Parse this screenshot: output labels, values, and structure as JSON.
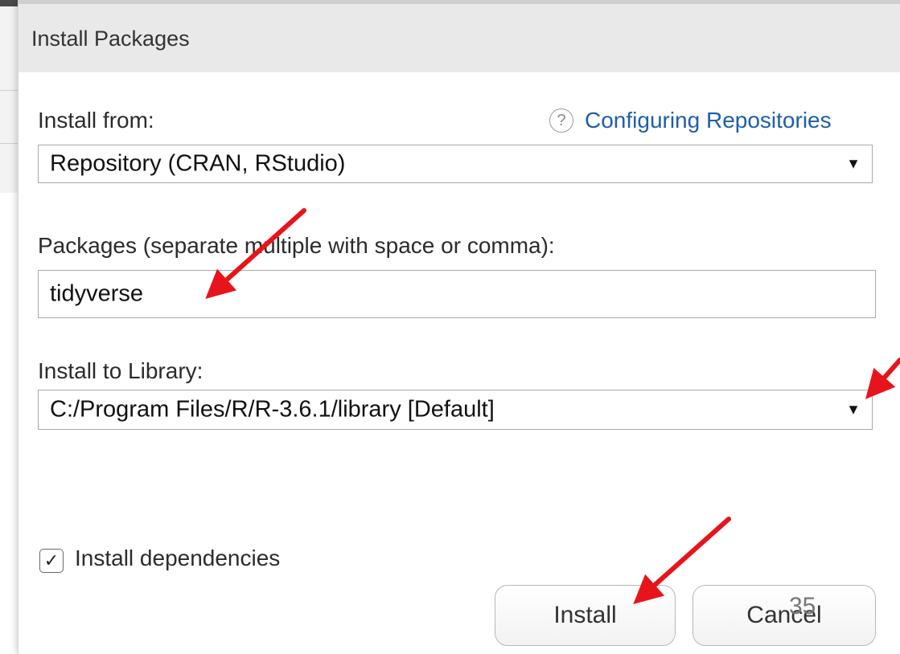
{
  "dialog": {
    "title": "Install Packages"
  },
  "install_from": {
    "label": "Install from:",
    "value": "Repository (CRAN, RStudio)",
    "help_link": "Configuring Repositories",
    "help_icon": "question-mark-icon"
  },
  "packages": {
    "label": "Packages (separate multiple with space or comma):",
    "value": "tidyverse"
  },
  "library": {
    "label": "Install to Library:",
    "value": "C:/Program Files/R/R-3.6.1/library [Default]"
  },
  "dependencies": {
    "label": "Install dependencies",
    "checked": true
  },
  "buttons": {
    "install": "Install",
    "cancel": "Cancel"
  },
  "slide_number": "35",
  "annotation_color": "#e8141b"
}
